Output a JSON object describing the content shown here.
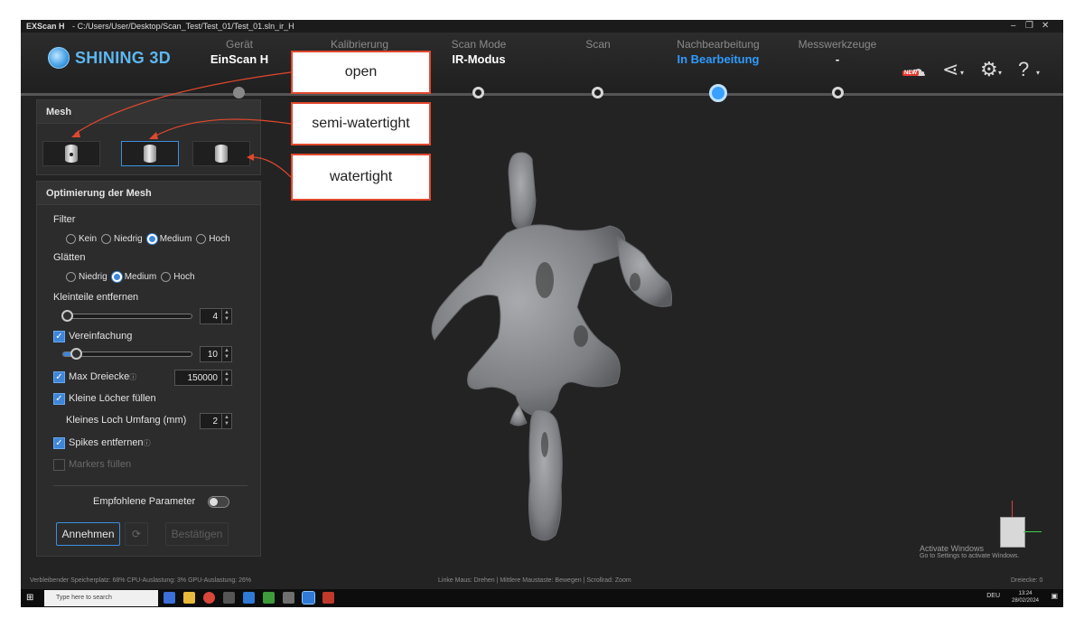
{
  "titlebar": {
    "app": "EXScan H",
    "path": "C:/Users/User/Desktop/Scan_Test/Test_01/Test_01.sln_ir_H"
  },
  "logo": {
    "text": "SHINING 3D"
  },
  "steps": [
    {
      "label": "Gerät",
      "value": "EinScan H"
    },
    {
      "label": "Kalibrierung",
      "value": ""
    },
    {
      "label": "Scan Mode",
      "value": "IR-Modus"
    },
    {
      "label": "Scan",
      "value": ""
    },
    {
      "label": "Nachbearbeitung",
      "value": "In Bearbeitung"
    },
    {
      "label": "Messwerkzeuge",
      "value": "-"
    }
  ],
  "header_icons": {
    "new_badge": "NEW"
  },
  "mesh_panel": {
    "title": "Mesh"
  },
  "optimize": {
    "title": "Optimierung der Mesh",
    "filter_label": "Filter",
    "filter_options": [
      "Kein",
      "Niedrig",
      "Medium",
      "Hoch"
    ],
    "filter_selected": "Medium",
    "smooth_label": "Glätten",
    "smooth_options": [
      "Niedrig",
      "Medium",
      "Hoch"
    ],
    "smooth_selected": "Medium",
    "small_parts_label": "Kleinteile entfernen",
    "small_parts_value": "4",
    "simplify_label": "Vereinfachung",
    "simplify_value": "10",
    "max_tri_label": "Max Dreiecke",
    "max_tri_value": "150000",
    "fill_holes_label": "Kleine Löcher füllen",
    "hole_perimeter_label": "Kleines Loch Umfang (mm)",
    "hole_perimeter_value": "2",
    "spikes_label": "Spikes entfernen",
    "markers_label": "Markers füllen",
    "recommended_label": "Empfohlene Parameter",
    "apply_label": "Annehmen",
    "confirm_label": "Bestätigen"
  },
  "callouts": {
    "open": "open",
    "semi": "semi-watertight",
    "watertight": "watertight"
  },
  "status": {
    "left": "Verbleibender Speicherplatz: 68%  CPU-Auslastung: 3%  GPU-Auslastung: 26%",
    "center": "Linke Maus: Drehen | Mittlere Maustaste: Bewegen | Scrollrad: Zoom",
    "right": "Dreiecke: 0"
  },
  "watermark": {
    "line1": "Activate Windows",
    "line2": "Go to Settings to activate Windows."
  },
  "taskbar": {
    "search_placeholder": "Type here to search",
    "lang": "DEU",
    "time": "13:24",
    "date": "28/02/2024"
  },
  "colors": {
    "accent": "#2f9bff",
    "callout_border": "#e0482e"
  }
}
